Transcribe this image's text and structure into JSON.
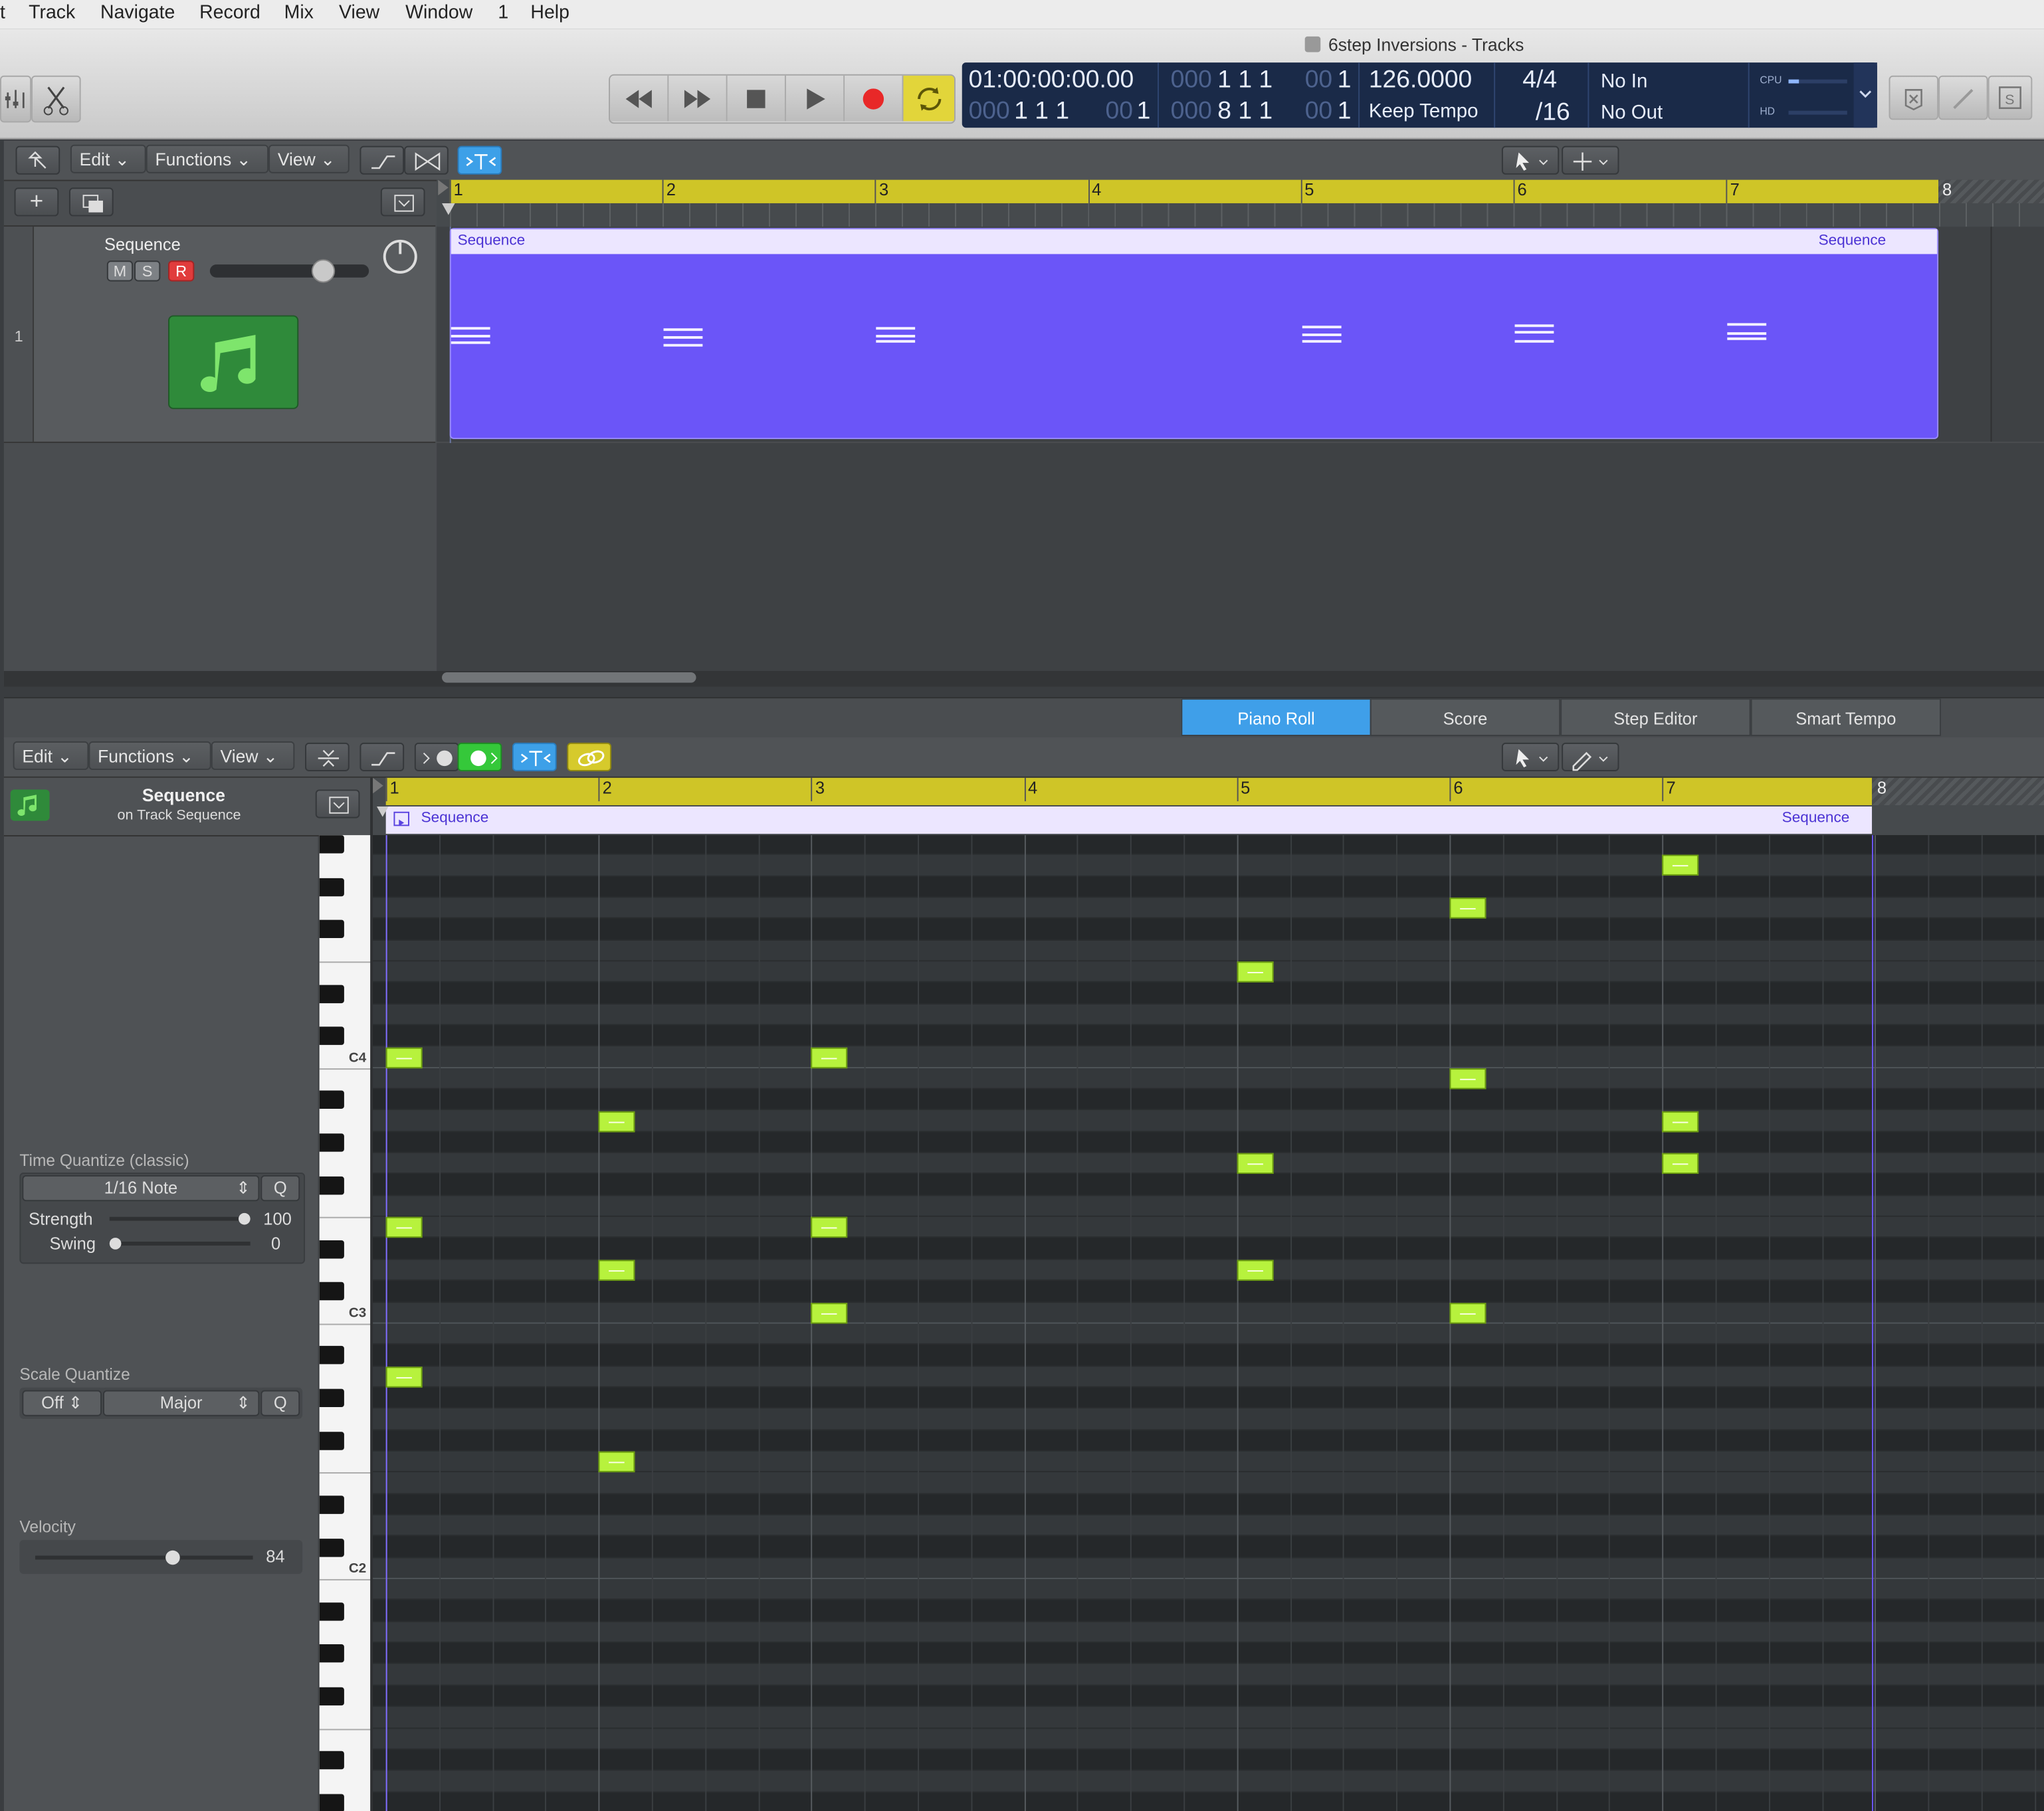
{
  "menubar": {
    "items": [
      "t",
      "Track",
      "Navigate",
      "Record",
      "Mix",
      "View",
      "Window",
      "1",
      "Help"
    ]
  },
  "window": {
    "title": "6step Inversions - Tracks"
  },
  "transport": {
    "time_smpte": "01:00:00:00.00",
    "position_top_dim": "000",
    "position_top": "1  1  1",
    "position_top_dim2": "00",
    "position_top_end": "1",
    "position_bottom_dim": "000",
    "position_bottom": "1  1  1",
    "position_bottom_dim2": "00",
    "position_bottom_end": "1",
    "cycle_top_dim": "000",
    "cycle_top": "1  1  1",
    "cycle_top_dim2": "00",
    "cycle_top_end": "1",
    "cycle_bottom_dim": "000",
    "cycle_bottom": "8  1  1",
    "cycle_bottom_dim2": "00",
    "cycle_bottom_end": "1",
    "tempo": "126.0000",
    "tempo_mode": "Keep Tempo",
    "time_signature": "4/4",
    "division": "/16",
    "midi_in": "No In",
    "midi_out": "No Out",
    "cpu_label": "CPU",
    "hd_label": "HD"
  },
  "tracks_toolbar": {
    "edit": "Edit",
    "functions": "Functions",
    "view": "View"
  },
  "tracks": {
    "track_number": "1",
    "track_name": "Sequence",
    "mute": "M",
    "solo": "S",
    "record": "R",
    "region_name_left": "Sequence",
    "region_name_right": "Sequence",
    "ruler_bars": [
      "1",
      "2",
      "3",
      "4",
      "5",
      "6",
      "7",
      "8"
    ]
  },
  "editor_tabs": {
    "piano_roll": "Piano Roll",
    "score": "Score",
    "step_editor": "Step Editor",
    "smart_tempo": "Smart Tempo"
  },
  "piano_toolbar": {
    "edit": "Edit",
    "functions": "Functions",
    "view": "View"
  },
  "piano_inspector": {
    "region_name": "Sequence",
    "region_track": "on Track Sequence",
    "time_quantize_title": "Time Quantize (classic)",
    "time_quantize_value": "1/16 Note",
    "q_label": "Q",
    "strength_label": "Strength",
    "strength_value": "100",
    "strength_fraction": 1.0,
    "swing_label": "Swing",
    "swing_value": "0",
    "swing_fraction": 0.0,
    "scale_quantize_title": "Scale Quantize",
    "scale_off": "Off",
    "scale_type": "Major",
    "velocity_title": "Velocity",
    "velocity_value": "84",
    "velocity_fraction": 0.64
  },
  "piano_roll": {
    "region_name_left": "Sequence",
    "region_name_right": "Sequence",
    "ruler_bars": [
      "1",
      "2",
      "3",
      "4",
      "5",
      "6",
      "7",
      "8"
    ],
    "key_labels": [
      "C4",
      "C3",
      "C2"
    ],
    "notes": [
      {
        "bar": 1,
        "pitch": "C4"
      },
      {
        "bar": 1,
        "pitch": "E3"
      },
      {
        "bar": 1,
        "pitch": "A2"
      },
      {
        "bar": 2,
        "pitch": "A3"
      },
      {
        "bar": 2,
        "pitch": "D3"
      },
      {
        "bar": 2,
        "pitch": "F2"
      },
      {
        "bar": 3,
        "pitch": "C4"
      },
      {
        "bar": 3,
        "pitch": "E3"
      },
      {
        "bar": 3,
        "pitch": "C3"
      },
      {
        "bar": 5,
        "pitch": "E4"
      },
      {
        "bar": 5,
        "pitch": "G3"
      },
      {
        "bar": 5,
        "pitch": "D3"
      },
      {
        "bar": 6,
        "pitch": "G4"
      },
      {
        "bar": 6,
        "pitch": "B3"
      },
      {
        "bar": 6,
        "pitch": "C3"
      },
      {
        "bar": 7,
        "pitch": "A4"
      },
      {
        "bar": 7,
        "pitch": "A3"
      },
      {
        "bar": 7,
        "pitch": "G3"
      }
    ]
  },
  "colors": {
    "region": "#6b55f8",
    "note": "#b7f23d",
    "ruler": "#cfc527",
    "active_tab": "#3f9fe9",
    "record": "#e82828",
    "cycle": "#e2d53a"
  }
}
